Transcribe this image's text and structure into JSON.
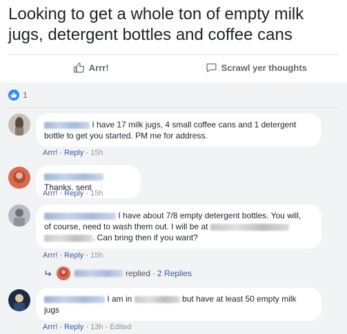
{
  "post": {
    "title": "Looking to get a whole ton of empty milk jugs, detergent bottles and coffee cans"
  },
  "actions": {
    "like_label": "Arrr!",
    "comment_label": "Scrawl yer thoughts"
  },
  "reactions": {
    "count": "1"
  },
  "comments": [
    {
      "text_a": "I have 17 milk jugs, 4 small coffee cans and 1 detergent",
      "text_b": "bottle to get you started. PM me for address.",
      "like": "Arrr!",
      "reply": "Reply",
      "time": "15h"
    },
    {
      "text_a": "Thanks. sent",
      "like": "Arrr!",
      "reply": "Reply",
      "time": "15h"
    },
    {
      "text_a": "I have about 7/8 empty detergent bottles. You will,",
      "text_b": "of course, need to wash them out. I will be at",
      "text_c": ". Can bring then if you want?",
      "like": "Arrr!",
      "reply": "Reply",
      "time": "15h",
      "replies": {
        "replied": "replied",
        "count_label": "2 Replies"
      }
    },
    {
      "text_a": "I am in",
      "text_b": "but have at least 50 empty milk",
      "text_c": "jugs",
      "like": "Arrr!",
      "reply": "Reply",
      "time": "13h",
      "edited": "Edited"
    }
  ],
  "colors": {
    "link": "#385898",
    "like_blue": "#2d88ff",
    "bg_panel": "#f2f3f5"
  }
}
